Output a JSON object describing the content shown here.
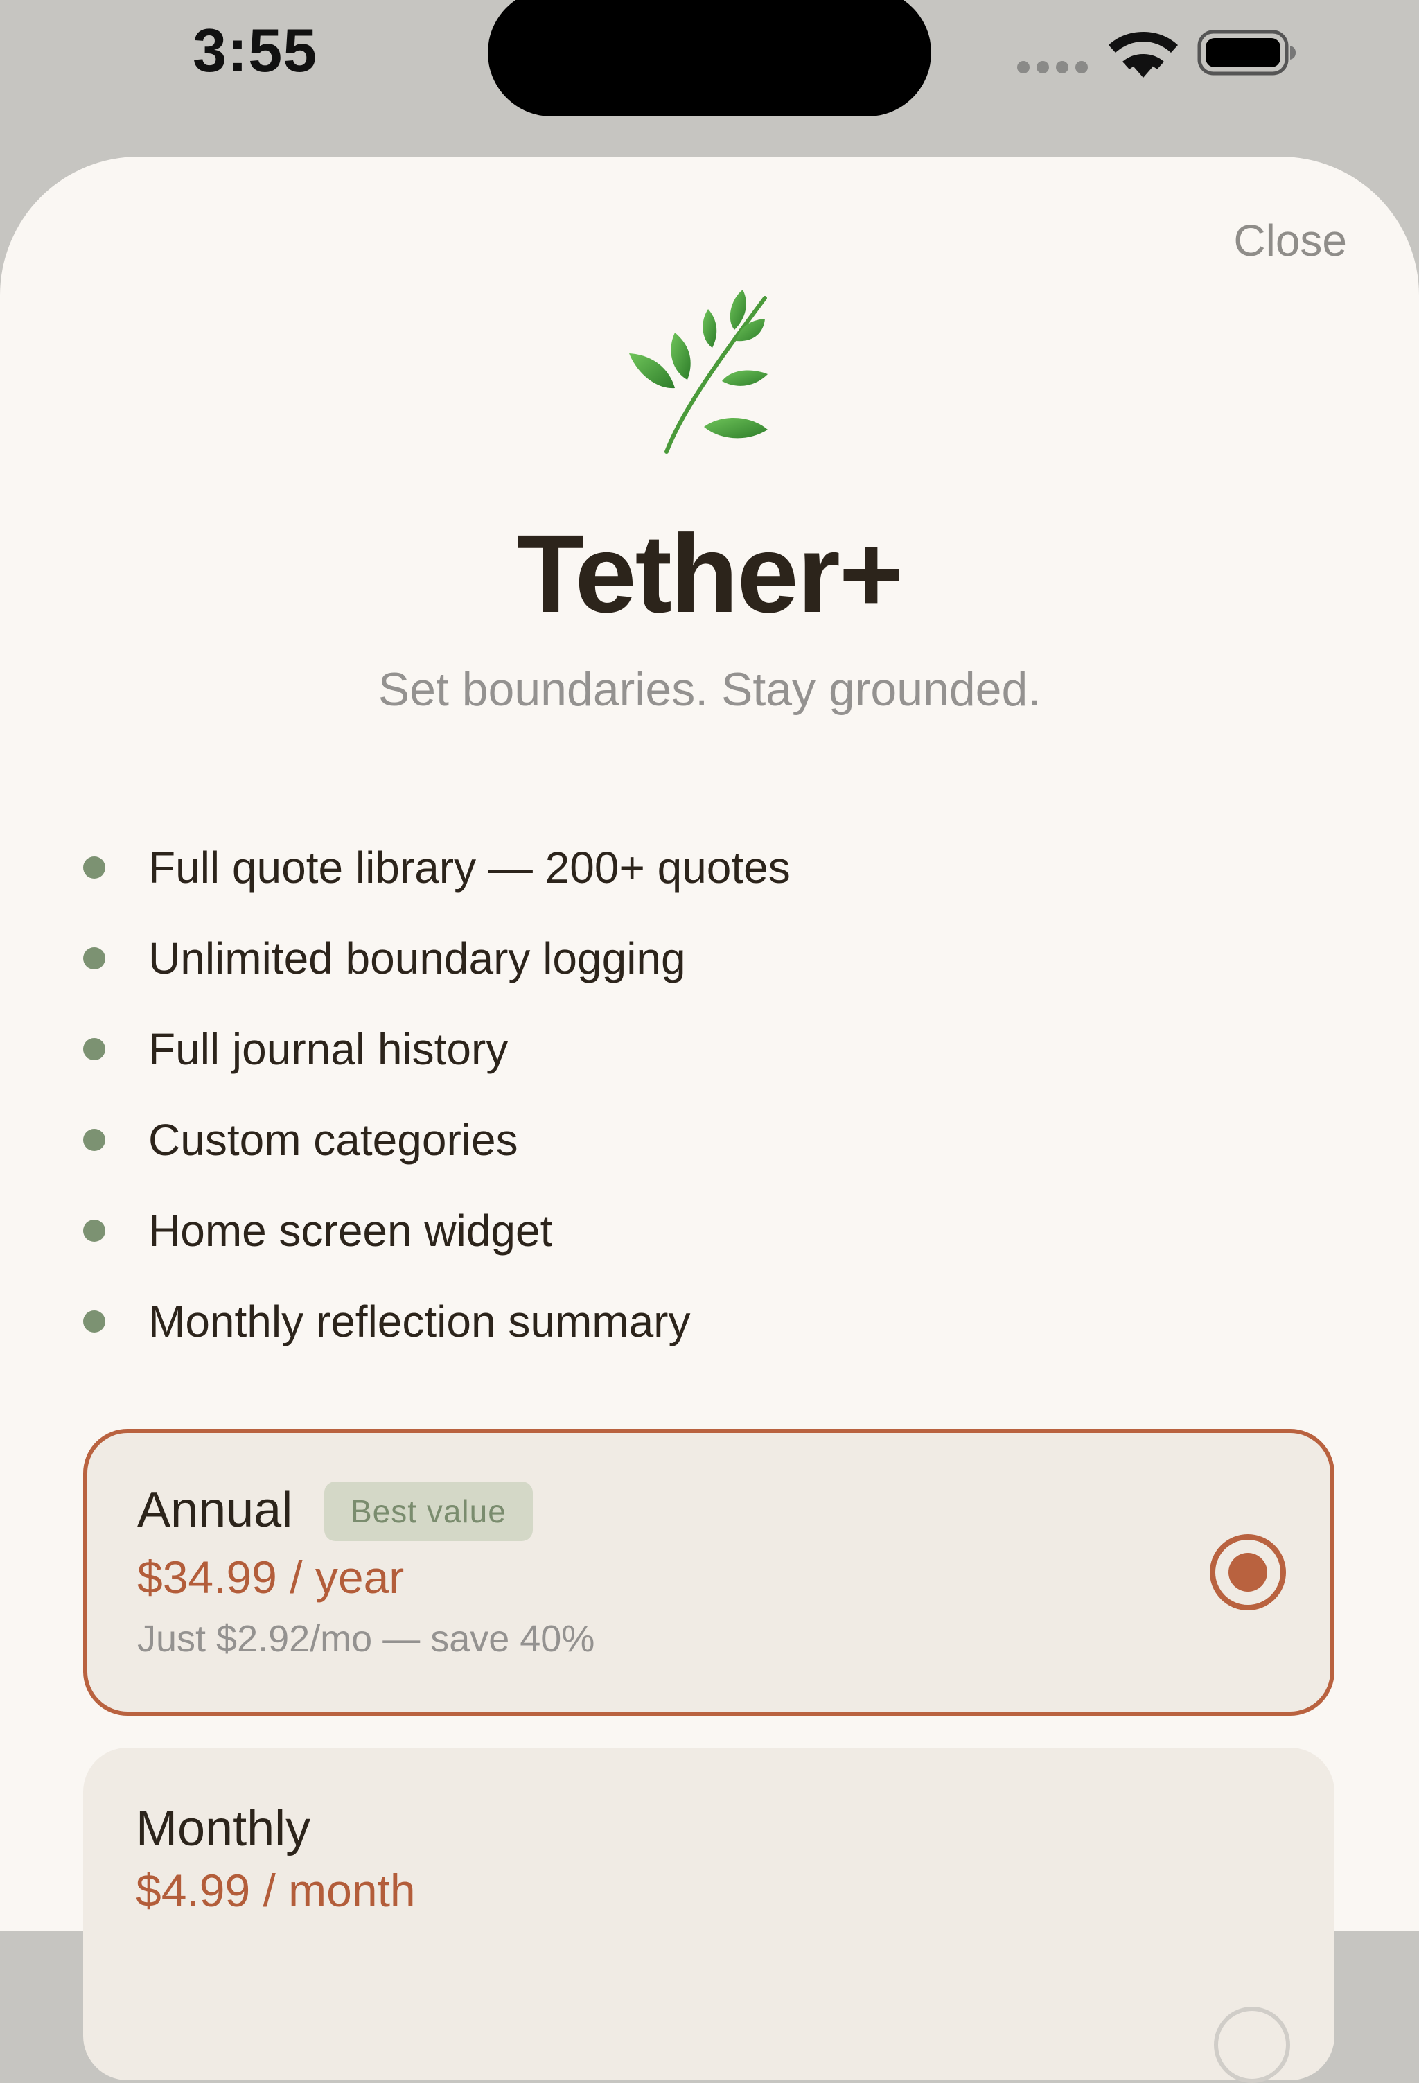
{
  "status_bar": {
    "time": "3:55"
  },
  "icons": {
    "hero": "herb-icon",
    "wifi": "wifi-icon",
    "battery": "battery-icon"
  },
  "colors": {
    "accent": "#b9623f",
    "price": "#b35d3a",
    "bullet": "#7c9272",
    "badge_bg": "#d4d8c7",
    "badge_text": "#7a8c6e",
    "sheet_bg": "#faf7f3",
    "card_bg": "#f0ebe4",
    "title": "#2c241b",
    "muted": "#949290"
  },
  "paywall": {
    "close_label": "Close",
    "title": "Tether+",
    "subtitle": "Set boundaries. Stay grounded.",
    "features": [
      {
        "label": "Full quote library — 200+ quotes"
      },
      {
        "label": "Unlimited boundary logging"
      },
      {
        "label": "Full journal history"
      },
      {
        "label": "Custom categories"
      },
      {
        "label": "Home screen widget"
      },
      {
        "label": "Monthly reflection summary"
      }
    ],
    "plans": [
      {
        "name": "Annual",
        "badge": "Best value",
        "price": "$34.99 / year",
        "note": "Just $2.92/mo — save 40%",
        "selected": true
      },
      {
        "name": "Monthly",
        "price": "$4.99 / month",
        "selected": false
      }
    ]
  }
}
